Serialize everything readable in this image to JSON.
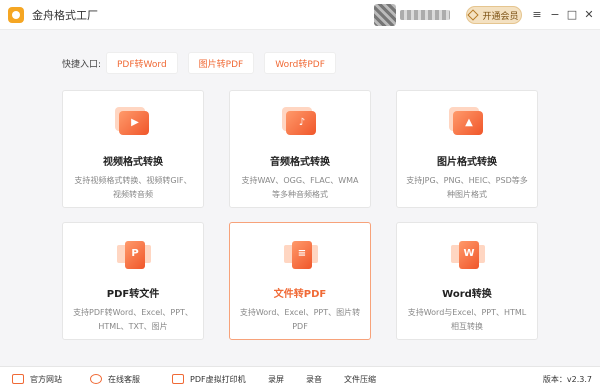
{
  "app": {
    "title": "金舟格式工厂",
    "vip_label": "开通会员"
  },
  "window": {
    "menu_glyph": "≡",
    "minimize_glyph": "−",
    "maximize_glyph": "□",
    "close_glyph": "✕"
  },
  "quick_entry": {
    "label": "快捷入口:",
    "buttons": [
      "PDF转Word",
      "图片转PDF",
      "Word转PDF"
    ]
  },
  "cards": [
    {
      "title": "视频格式转换",
      "desc": "支持视频格式转换、视频转GIF、视频转音频",
      "icon": "video-icon",
      "glyph": "▶"
    },
    {
      "title": "音频格式转换",
      "desc": "支持WAV、OGG、FLAC、WMA等多种音频格式",
      "icon": "audio-icon",
      "glyph": "♪"
    },
    {
      "title": "图片格式转换",
      "desc": "支持JPG、PNG、HEIC、PSD等多种图片格式",
      "icon": "image-icon",
      "glyph": "▲"
    },
    {
      "title": "PDF转文件",
      "desc": "支持PDF转Word、Excel、PPT、HTML、TXT、图片",
      "icon": "pdf-doc-icon",
      "glyph": "P"
    },
    {
      "title": "文件转PDF",
      "desc": "支持Word、Excel、PPT、图片转PDF",
      "icon": "file-doc-icon",
      "glyph": "≡"
    },
    {
      "title": "Word转换",
      "desc": "支持Word与Excel、PPT、HTML相互转换",
      "icon": "word-doc-icon",
      "glyph": "W"
    }
  ],
  "footer": {
    "items": [
      "官方网站",
      "在线客服",
      "PDF虚拟打印机",
      "录屏",
      "录音",
      "文件压缩"
    ],
    "version": "版本：v2.3.7"
  },
  "colors": {
    "accent": "#f06a36",
    "vip_bg": "#f4e1c1"
  }
}
